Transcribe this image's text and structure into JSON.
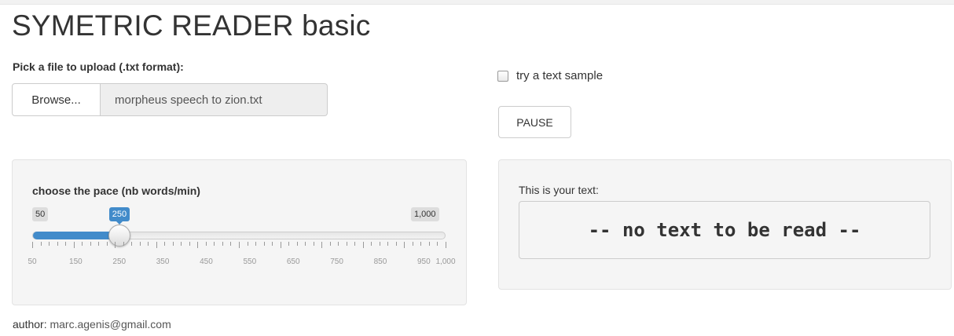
{
  "app": {
    "title": "SYMETRIC READER basic"
  },
  "upload": {
    "label": "Pick a file to upload (.txt format):",
    "browse_label": "Browse...",
    "file_name": "morpheus speech to zion.txt"
  },
  "sample": {
    "label": "try a text sample",
    "checked": false
  },
  "pause": {
    "label": "PAUSE"
  },
  "pace": {
    "label": "choose the pace (nb words/min)",
    "min_label": "50",
    "max_label": "1,000",
    "value_label": "250",
    "min": 50,
    "max": 1000,
    "value": 250,
    "ticks": [
      "50",
      "150",
      "250",
      "350",
      "450",
      "550",
      "650",
      "750",
      "850",
      "950",
      "1,000"
    ],
    "accent_color": "#428bca"
  },
  "reader": {
    "label": "This is your text:",
    "content": "-- no text to be read --"
  },
  "author": {
    "label": "author:",
    "email": "marc.agenis@gmail.com"
  }
}
